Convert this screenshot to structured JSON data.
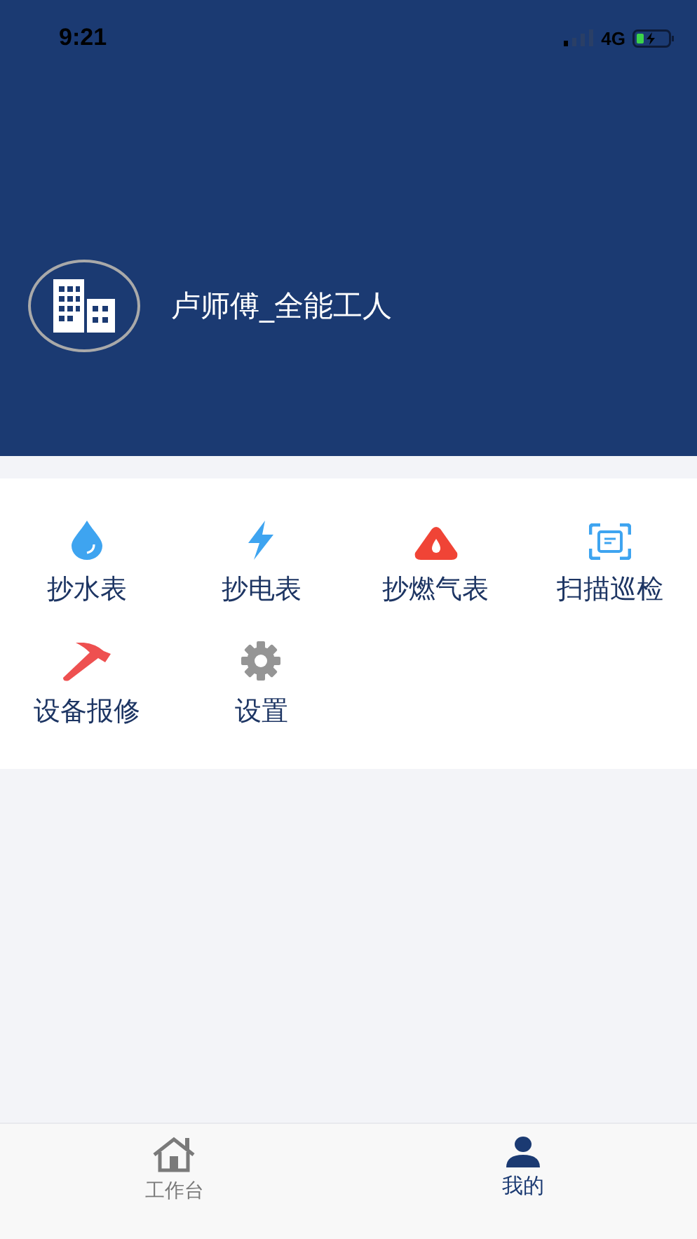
{
  "status_bar": {
    "time": "9:21",
    "network": "4G"
  },
  "profile": {
    "name": "卢师傅_全能工人"
  },
  "menu": [
    {
      "kind": "water",
      "label": "抄水表"
    },
    {
      "kind": "power",
      "label": "抄电表"
    },
    {
      "kind": "gas",
      "label": "抄燃气表"
    },
    {
      "kind": "scan",
      "label": "扫描巡检"
    },
    {
      "kind": "repair",
      "label": "设备报修"
    },
    {
      "kind": "settings",
      "label": "设置"
    }
  ],
  "tab_bar": [
    {
      "kind": "home",
      "label": "工作台",
      "selected": false
    },
    {
      "kind": "person",
      "label": "我的",
      "selected": true
    }
  ]
}
